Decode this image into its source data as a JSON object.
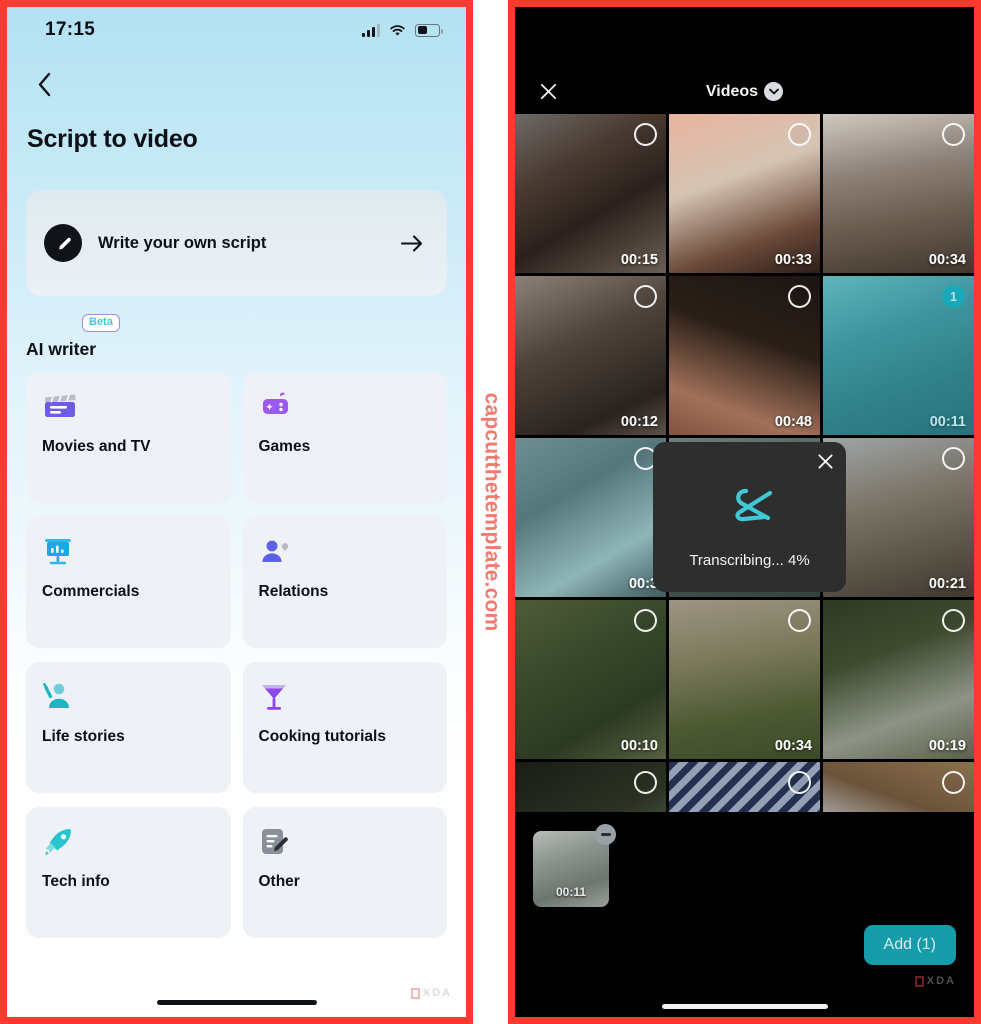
{
  "watermark": {
    "text": "capcutthetemplate.com",
    "color": "#f4796e"
  },
  "left_phone": {
    "status_bar": {
      "time": "17:15",
      "signal_icon": "cellular-signal-icon",
      "wifi_icon": "wifi-icon",
      "battery_icon": "battery-icon"
    },
    "back_icon": "back-chevron-icon",
    "page_title": "Script to video",
    "script_card": {
      "icon": "pencil-edit-icon",
      "label": "Write your own script",
      "arrow_icon": "arrow-right-icon"
    },
    "section": {
      "title": "AI writer",
      "badge": "Beta",
      "badge_color": "#46c7d6"
    },
    "categories": [
      {
        "label": "Movies and TV",
        "icon": "clapperboard-icon",
        "color": "#6c5ce7"
      },
      {
        "label": "Games",
        "icon": "gamepad-icon",
        "color": "#9b59f0"
      },
      {
        "label": "Commercials",
        "icon": "presentation-chart-icon",
        "color": "#1ea7e8"
      },
      {
        "label": "Relations",
        "icon": "people-icon",
        "color": "#5b62e8"
      },
      {
        "label": "Life stories",
        "icon": "person-waving-icon",
        "color": "#1bb6c4"
      },
      {
        "label": "Cooking tutorials",
        "icon": "cocktail-glass-icon",
        "color": "#8e44f0"
      },
      {
        "label": "Tech info",
        "icon": "rocket-icon",
        "color": "#27c3cf"
      },
      {
        "label": "Other",
        "icon": "note-pencil-icon",
        "color": "#8a9099"
      }
    ],
    "watermark_logo": "xda-logo",
    "home_indicator": "home-indicator"
  },
  "right_phone": {
    "header": {
      "close_icon": "close-x-icon",
      "title": "Videos",
      "chevron_icon": "chevron-down-icon"
    },
    "grid": [
      {
        "duration": "00:15",
        "selected": false,
        "badge": "",
        "tone": "dark-brown-bedroom"
      },
      {
        "duration": "00:33",
        "selected": false,
        "badge": "",
        "tone": "peach-fabric"
      },
      {
        "duration": "00:34",
        "selected": false,
        "badge": "",
        "tone": "dog-room"
      },
      {
        "duration": "00:12",
        "selected": false,
        "badge": "",
        "tone": "dark-sofa"
      },
      {
        "duration": "00:48",
        "selected": false,
        "badge": "",
        "tone": "dark-animal"
      },
      {
        "duration": "00:11",
        "selected": true,
        "badge": "1",
        "tone": "teal-rocks"
      },
      {
        "duration": "00:3",
        "selected": false,
        "badge": "",
        "tone": "teal-stones"
      },
      {
        "duration": "",
        "selected": false,
        "badge": "",
        "tone": "hidden-center"
      },
      {
        "duration": "00:21",
        "selected": false,
        "badge": "",
        "tone": "gray-stairs"
      },
      {
        "duration": "00:10",
        "selected": false,
        "badge": "",
        "tone": "green-tree"
      },
      {
        "duration": "00:34",
        "selected": false,
        "badge": "",
        "tone": "green-field"
      },
      {
        "duration": "00:19",
        "selected": false,
        "badge": "",
        "tone": "green-rocks"
      },
      {
        "duration": "",
        "selected": false,
        "badge": "",
        "tone": "dark-grass"
      },
      {
        "duration": "",
        "selected": false,
        "badge": "",
        "tone": "blue-stripes"
      },
      {
        "duration": "",
        "selected": false,
        "badge": "",
        "tone": "pale-sky"
      }
    ],
    "modal": {
      "logo": "capcut-logo-icon",
      "text": "Transcribing... 4%",
      "close_icon": "close-x-icon",
      "progress_percent": 4,
      "accent_color": "#3fc8d6"
    },
    "tray": {
      "selected_clip": {
        "duration": "00:11",
        "remove_icon": "minus-circle-icon"
      },
      "add_button": "Add (1)",
      "add_button_color": "#169ca9",
      "watermark_logo": "xda-logo",
      "home_indicator": "home-indicator"
    }
  }
}
